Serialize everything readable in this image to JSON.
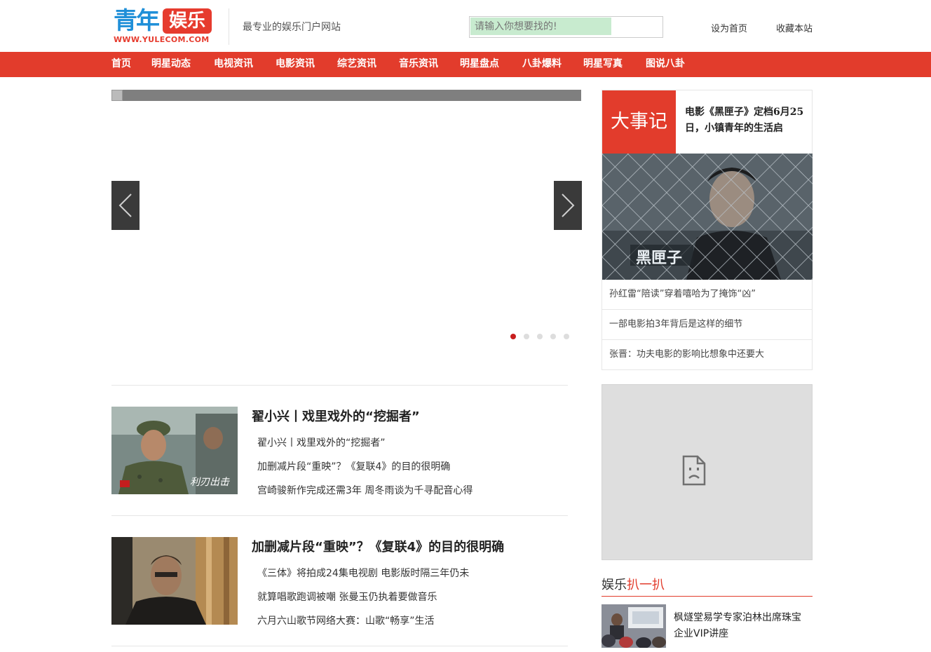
{
  "header": {
    "logo_main": "青年",
    "logo_badge": "娱乐",
    "logo_url": "WWW.YULECOM.COM",
    "slogan": "最专业的娱乐门户网站",
    "search_placeholder": "请输入你想要找的!",
    "links": [
      "设为首页",
      "收藏本站"
    ]
  },
  "nav": [
    "首页",
    "明星动态",
    "电视资讯",
    "电影资讯",
    "综艺资讯",
    "音乐资讯",
    "明星盘点",
    "八卦爆料",
    "明星写真",
    "图说八卦"
  ],
  "slider": {
    "dots": 5,
    "active_dot": 0
  },
  "news": [
    {
      "title": "翟小兴丨戏里戏外的“挖掘者”",
      "items": [
        "翟小兴丨戏里戏外的“挖掘者”",
        "加删减片段“重映”？《复联4》的目的很明确",
        "宫崎骏新作完成还需3年  周冬雨谈为千寻配音心得"
      ]
    },
    {
      "title": "加删减片段“重映”？《复联4》的目的很明确",
      "items": [
        "《三体》将拍成24集电视剧  电影版时隔三年仍未",
        "就算唱歌跑调被嘲 张曼玉仍执着要做音乐",
        "六月六山歌节网络大赛：山歌“畅享”生活"
      ]
    }
  ],
  "events": {
    "tag": "大事记",
    "title": "电影《黑匣子》定档6月25日，小镇青年的生活启",
    "items": [
      "孙红雷“陪读”穿着嘻哈为了掩饰“凶”",
      "一部电影拍3年背后是这样的细节",
      "张晋：功夫电影的影响比想象中还要大"
    ]
  },
  "section": {
    "title_black": "娱乐",
    "title_red": "扒一扒"
  },
  "side_news": {
    "title": "枫燧堂易学专家泊林出席珠宝企业VIP讲座"
  },
  "colors": {
    "brand_red": "#e23c2c",
    "brand_blue": "#1f8fd8",
    "search_bg": "#c8ebcf"
  }
}
